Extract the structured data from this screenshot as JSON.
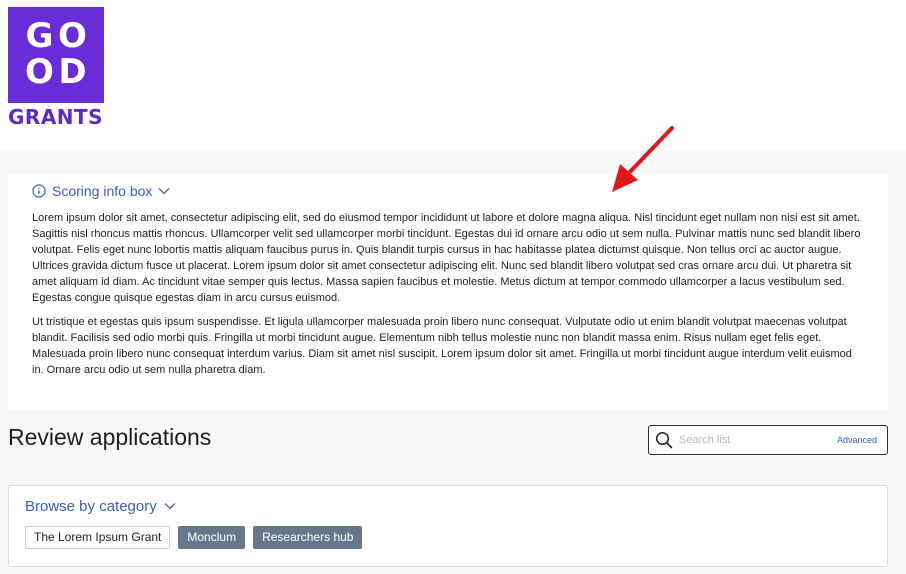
{
  "logo": {
    "row1": [
      "G",
      "O"
    ],
    "row2": [
      "O",
      "D"
    ],
    "word": "GRANTS"
  },
  "info_box": {
    "label": "Scoring info box",
    "paragraphs": [
      "Lorem ipsum dolor sit amet, consectetur adipiscing elit, sed do eiusmod tempor incididunt ut labore et dolore magna aliqua. Nisl tincidunt eget nullam non nisi est sit amet. Sagittis nisl rhoncus mattis rhoncus. Ullamcorper velit sed ullamcorper morbi tincidunt. Egestas dui id ornare arcu odio ut sem nulla. Pulvinar mattis nunc sed blandit libero volutpat. Felis eget nunc lobortis mattis aliquam faucibus purus in. Quis blandit turpis cursus in hac habitasse platea dictumst quisque. Non tellus orci ac auctor augue. Ultrices gravida dictum fusce ut placerat. Lorem ipsum dolor sit amet consectetur adipiscing elit. Nunc sed blandit libero volutpat sed cras ornare arcu dui. Ut pharetra sit amet aliquam id diam. Ac tincidunt vitae semper quis lectus. Massa sapien faucibus et molestie. Metus dictum at tempor commodo ullamcorper a lacus vestibulum sed. Egestas congue quisque egestas diam in arcu cursus euismod.",
      "Ut tristique et egestas quis ipsum suspendisse. Et ligula ullamcorper malesuada proin libero nunc consequat. Vulputate odio ut enim blandit volutpat maecenas volutpat blandit. Facilisis sed odio morbi quis. Fringilla ut morbi tincidunt augue. Elementum nibh tellus molestie nunc non blandit massa enim. Risus nullam eget felis eget. Malesuada proin libero nunc consequat interdum varius. Diam sit amet nisl suscipit. Lorem ipsum dolor sit amet. Fringilla ut morbi tincidunt augue interdum velit euismod in. Ornare arcu odio ut sem nulla pharetra diam."
    ]
  },
  "review": {
    "title": "Review applications",
    "search_placeholder": "Search list",
    "advanced_label": "Advanced"
  },
  "browse": {
    "label": "Browse by category",
    "tags": [
      "The Lorem Ipsum Grant",
      "Monclum",
      "Researchers hub"
    ]
  },
  "colors": {
    "brand": "#6a2bd8",
    "link": "#3c5bc8",
    "tag_filled": "#68768a",
    "arrow": "#e0171c"
  }
}
